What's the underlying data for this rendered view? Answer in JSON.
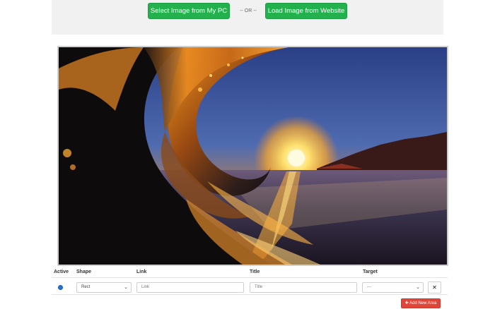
{
  "toolbar": {
    "select_label": "Select Image from My PC",
    "or_label": "-- OR --",
    "load_label": "Load Image from Website"
  },
  "image": {
    "description": "Photo of a curling ocean wave lit by the setting sun"
  },
  "areas_table": {
    "headers": {
      "active": "Active",
      "shape": "Shape",
      "link": "Link",
      "title": "Title",
      "target": "Target"
    },
    "rows": [
      {
        "active": true,
        "shape_value": "Rect",
        "link_placeholder": "Link",
        "title_placeholder": "Title",
        "target_value": "---"
      }
    ],
    "remove_label": "✕"
  },
  "add_area_label": "✚ Add New Area",
  "colors": {
    "accent_green": "#22b14c",
    "danger_red": "#e0453a",
    "radio_blue": "#2a6fd6"
  }
}
